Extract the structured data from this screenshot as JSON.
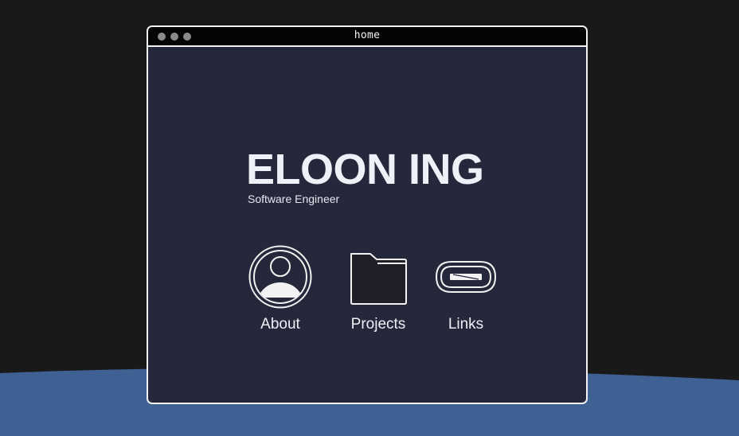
{
  "window": {
    "title": "home",
    "controls": [
      "close",
      "minimize",
      "maximize"
    ]
  },
  "hero": {
    "name": "ELOON ING",
    "role": "Software Engineer"
  },
  "apps": [
    {
      "label": "About",
      "icon": "user-icon"
    },
    {
      "label": "Projects",
      "icon": "folder-icon"
    },
    {
      "label": "Links",
      "icon": "link-icon"
    }
  ],
  "colors": {
    "desktop": "#191919",
    "hill": "#3f6093",
    "window_bg": "#25273b",
    "titlebar": "#050505",
    "border": "#f2f2f2",
    "text": "#eef1f7"
  }
}
